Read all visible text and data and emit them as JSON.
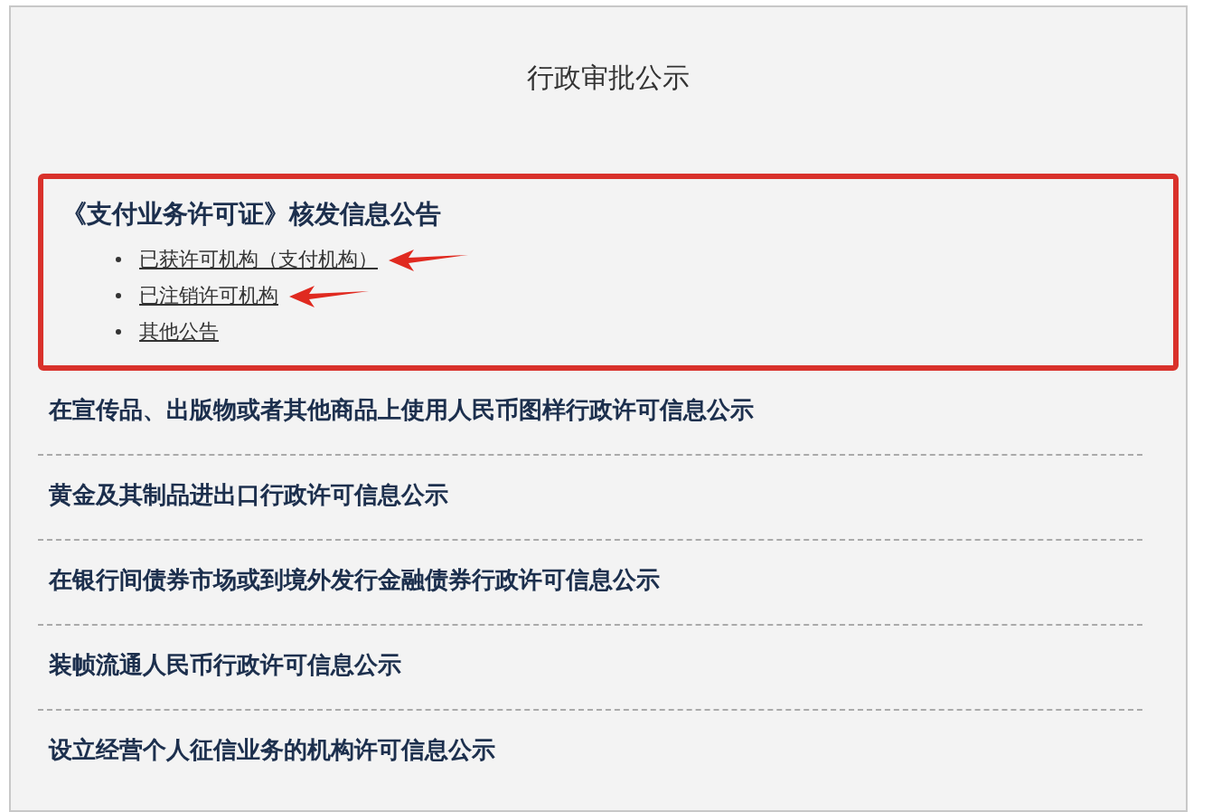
{
  "title": "行政审批公示",
  "featured": {
    "heading": "《支付业务许可证》核发信息公告",
    "highlighted": true,
    "links": [
      {
        "label": "已获许可机构（支付机构）",
        "arrow": true
      },
      {
        "label": "已注销许可机构",
        "arrow": true
      },
      {
        "label": "其他公告",
        "arrow": false
      }
    ]
  },
  "items": [
    "在宣传品、出版物或者其他商品上使用人民币图样行政许可信息公示",
    "黄金及其制品进出口行政许可信息公示",
    "在银行间债券市场或到境外发行金融债券行政许可信息公示",
    "装帧流通人民币行政许可信息公示",
    "设立经营个人征信业务的机构许可信息公示"
  ]
}
